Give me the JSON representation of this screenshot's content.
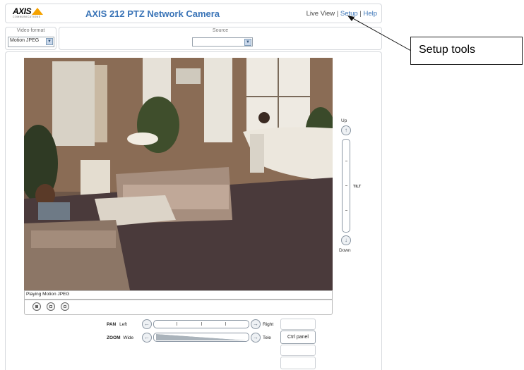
{
  "header": {
    "logo_text": "AXIS",
    "logo_tagline": "COMMUNICATIONS",
    "title": "AXIS 212 PTZ Network Camera",
    "nav": [
      {
        "label": "Live View",
        "active": false
      },
      {
        "label": "Setup",
        "active": true
      },
      {
        "label": "Help",
        "active": true
      }
    ],
    "separator": "|"
  },
  "video_format": {
    "label": "Video format",
    "value": "Motion JPEG"
  },
  "source": {
    "label": "Source",
    "value": ""
  },
  "player": {
    "status": "Playing Motion JPEG",
    "buttons": [
      "stop-icon",
      "snapshot-icon",
      "fullscreen-icon"
    ]
  },
  "tilt": {
    "up_label": "Up",
    "down_label": "Down",
    "label": "TILT"
  },
  "pan": {
    "label": "PAN",
    "left_label": "Left",
    "right_label": "Right"
  },
  "zoom": {
    "label": "ZOOM",
    "wide_label": "Wide",
    "tele_label": "Tele"
  },
  "ctrl_panel_label": "Ctrl panel",
  "callout": {
    "text": "Setup tools"
  },
  "colors": {
    "brand_blue": "#3a74b7",
    "logo_orange": "#f5a200",
    "border_gray": "#d6d9dd"
  }
}
